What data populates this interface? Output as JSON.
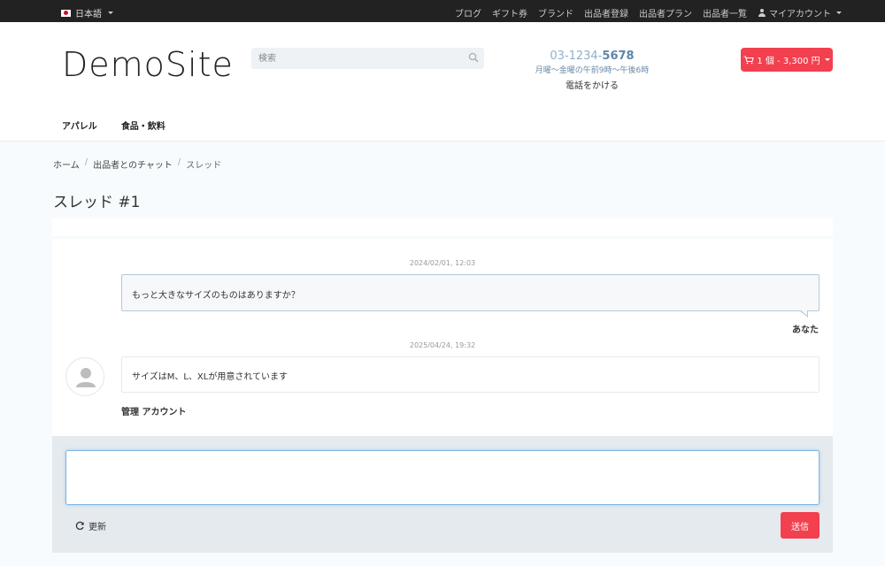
{
  "topbar": {
    "language": "日本語",
    "links": [
      "ブログ",
      "ギフト券",
      "ブランド",
      "出品者登録",
      "出品者プラン",
      "出品者一覧"
    ],
    "account": "マイアカウント"
  },
  "header": {
    "logo": "DemoSite",
    "search_placeholder": "検索",
    "phone_prefix": "03-1234-",
    "phone_suffix": "5678",
    "hours": "月曜〜金曜の午前9時〜午後6時",
    "call_label": "電話をかける",
    "cart_label": "1 個 - 3,300 円"
  },
  "nav": [
    "アパレル",
    "食品・飲料"
  ],
  "breadcrumb": {
    "home": "ホーム",
    "chat": "出品者とのチャット",
    "current": "スレッド"
  },
  "page_title": "スレッド #1",
  "messages": [
    {
      "timestamp": "2024/02/01, 12:03",
      "text": "もっと大きなサイズのものはありますか？",
      "author": "あなた"
    },
    {
      "timestamp": "2025/04/24, 19:32",
      "text": "サイズはM、L、XLが用意されています",
      "author": "管理 アカウント"
    }
  ],
  "compose": {
    "refresh_label": "更新",
    "send_label": "送信"
  },
  "colors": {
    "accent": "#f2404f",
    "topbar": "#222222",
    "phone": "#5f86a8"
  }
}
